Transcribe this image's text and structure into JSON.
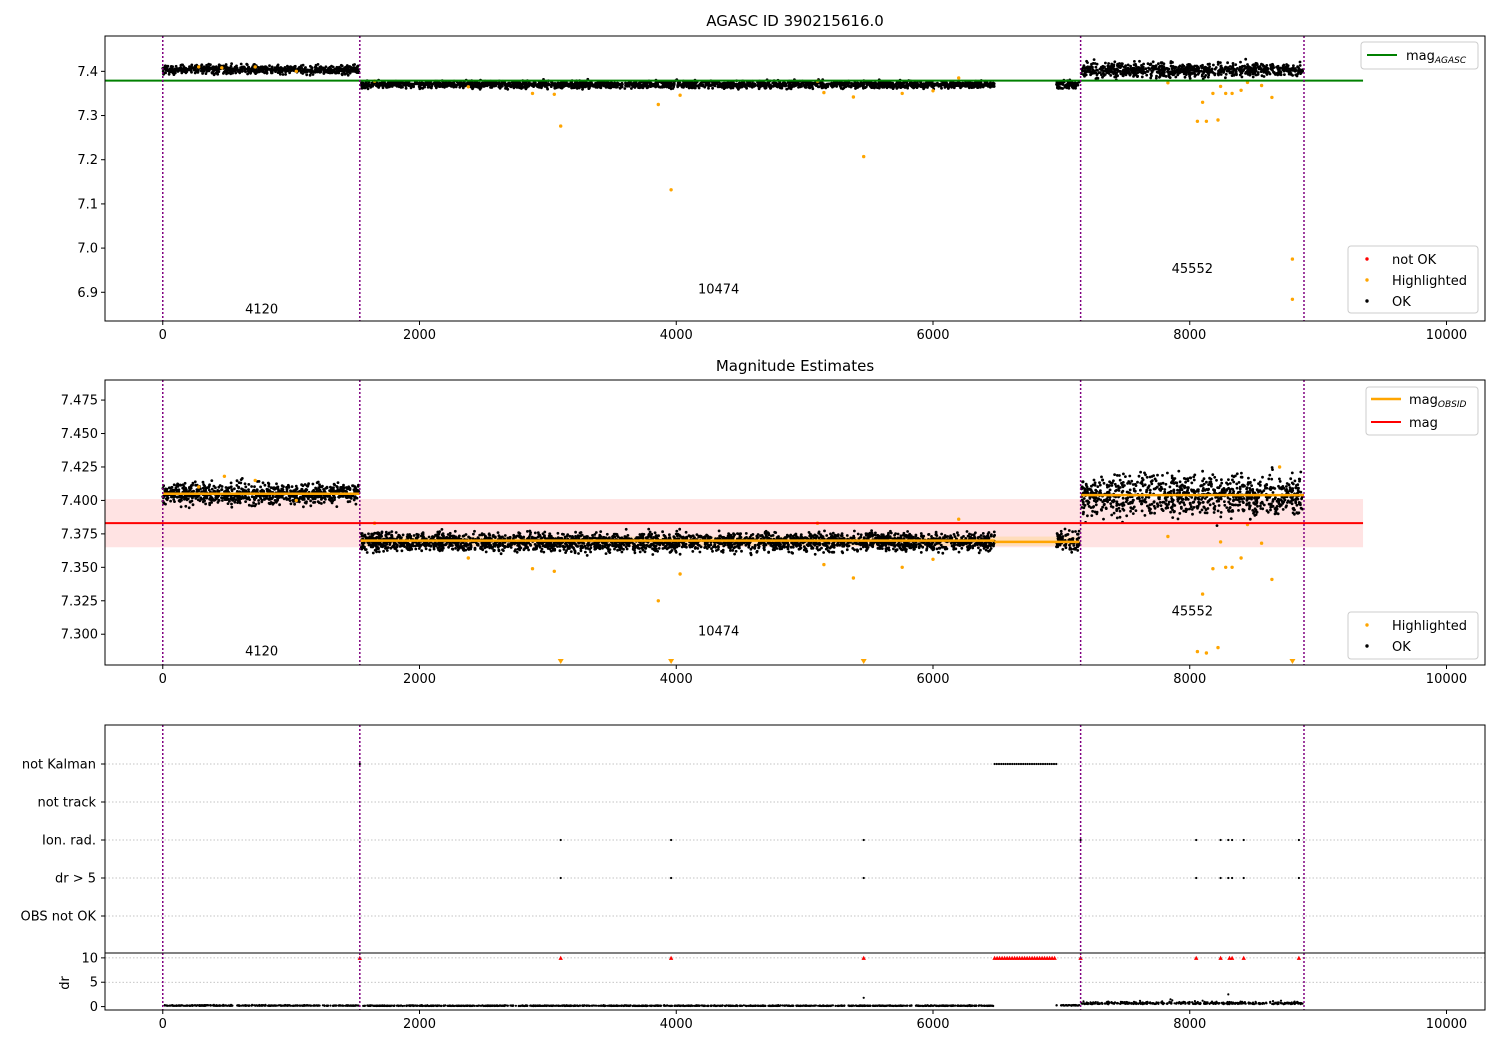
{
  "chart_data": [
    {
      "type": "scatter",
      "title": "AGASC ID 390215616.0",
      "xlim": [
        -450,
        10300
      ],
      "ylim": [
        6.835,
        7.48
      ],
      "xticks": [
        0,
        2000,
        4000,
        6000,
        8000,
        10000
      ],
      "yticks": [
        6.9,
        7.0,
        7.1,
        7.2,
        7.3,
        7.4
      ],
      "xtick_labels": [
        "0",
        "2000",
        "4000",
        "6000",
        "8000",
        "10000"
      ],
      "ytick_labels": [
        "6.9",
        "7.0",
        "7.1",
        "7.2",
        "7.3",
        "7.4"
      ],
      "obs_boundaries": [
        0,
        1535,
        7150,
        8890
      ],
      "obsid_labels": [
        {
          "text": "4120",
          "x": 770,
          "y": 6.852
        },
        {
          "text": "10474",
          "x": 4330,
          "y": 6.897
        },
        {
          "text": "45552",
          "x": 8020,
          "y": 6.944
        }
      ],
      "lines": [
        {
          "name": "mag_AGASC",
          "label_main": "mag",
          "label_sub": "AGASC",
          "color": "#008000",
          "y": 7.379,
          "x": [
            -450,
            9350
          ]
        }
      ],
      "ok_segments": [
        {
          "x": [
            0,
            1530
          ],
          "center": 7.404,
          "spread": 0.005
        },
        {
          "x": [
            1545,
            6480
          ],
          "center": 7.37,
          "spread": 0.004
        },
        {
          "x": [
            6960,
            7140
          ],
          "center": 7.37,
          "spread": 0.005
        },
        {
          "x": [
            7155,
            8880
          ],
          "center": 7.403,
          "spread": 0.008
        }
      ],
      "highlighted_points": [
        [
          280,
          7.41
        ],
        [
          460,
          7.408
        ],
        [
          720,
          7.41
        ],
        [
          1040,
          7.4
        ],
        [
          1650,
          7.378
        ],
        [
          2380,
          7.365
        ],
        [
          2880,
          7.35
        ],
        [
          3050,
          7.348
        ],
        [
          3100,
          7.276
        ],
        [
          3860,
          7.325
        ],
        [
          3960,
          7.132
        ],
        [
          4030,
          7.346
        ],
        [
          5100,
          7.378
        ],
        [
          5150,
          7.352
        ],
        [
          5380,
          7.342
        ],
        [
          5460,
          7.207
        ],
        [
          5760,
          7.35
        ],
        [
          6000,
          7.356
        ],
        [
          6200,
          7.385
        ],
        [
          7830,
          7.374
        ],
        [
          8060,
          7.287
        ],
        [
          8100,
          7.33
        ],
        [
          8130,
          7.287
        ],
        [
          8180,
          7.35
        ],
        [
          8220,
          7.29
        ],
        [
          8240,
          7.366
        ],
        [
          8280,
          7.35
        ],
        [
          8330,
          7.35
        ],
        [
          8400,
          7.357
        ],
        [
          8450,
          7.375
        ],
        [
          8560,
          7.368
        ],
        [
          8640,
          7.341
        ],
        [
          8800,
          6.975
        ],
        [
          8800,
          6.884
        ]
      ],
      "legend": {
        "position": "lower-right",
        "entries": [
          {
            "label": "not OK",
            "color": "#ff0000"
          },
          {
            "label": "Highlighted",
            "color": "#ffa500"
          },
          {
            "label": "OK",
            "color": "#000000"
          }
        ]
      }
    },
    {
      "type": "scatter",
      "title": "Magnitude Estimates",
      "xlim": [
        -450,
        10300
      ],
      "ylim": [
        7.277,
        7.49
      ],
      "xticks": [
        0,
        2000,
        4000,
        6000,
        8000,
        10000
      ],
      "yticks": [
        7.3,
        7.325,
        7.35,
        7.375,
        7.4,
        7.425,
        7.45,
        7.475
      ],
      "xtick_labels": [
        "0",
        "2000",
        "4000",
        "6000",
        "8000",
        "10000"
      ],
      "ytick_labels": [
        "7.300",
        "7.325",
        "7.350",
        "7.375",
        "7.400",
        "7.425",
        "7.450",
        "7.475"
      ],
      "obs_boundaries": [
        0,
        1535,
        7150,
        8890
      ],
      "obsid_labels": [
        {
          "text": "4120",
          "x": 770,
          "y": 7.284
        },
        {
          "text": "10474",
          "x": 4330,
          "y": 7.299
        },
        {
          "text": "45552",
          "x": 8020,
          "y": 7.314
        }
      ],
      "mag_band": {
        "x": [
          -450,
          9350
        ],
        "y": [
          7.365,
          7.401
        ],
        "color": "#ffb0b0"
      },
      "mag_obsid_band": {
        "x": [
          1545,
          7140
        ],
        "y": [
          7.366,
          7.373
        ],
        "color": "#ffd9a0"
      },
      "lines": [
        {
          "name": "mag_OBSID",
          "label_main": "mag",
          "label_sub": "OBSID",
          "color": "#ffa500",
          "segments": [
            {
              "x": [
                0,
                1535
              ],
              "y": 7.405
            },
            {
              "x": [
                1540,
                6480
              ],
              "y": 7.37
            },
            {
              "x": [
                6480,
                7140
              ],
              "y": 7.369
            },
            {
              "x": [
                7155,
                8890
              ],
              "y": 7.404
            }
          ]
        },
        {
          "name": "mag",
          "label_main": "mag",
          "label_sub": "",
          "color": "#ff0000",
          "y": 7.383,
          "x": [
            -450,
            9350
          ]
        }
      ],
      "ok_segments": [
        {
          "x": [
            0,
            1530
          ],
          "center": 7.405,
          "spread": 0.004
        },
        {
          "x": [
            1545,
            6480
          ],
          "center": 7.369,
          "spread": 0.0035
        },
        {
          "x": [
            6960,
            7140
          ],
          "center": 7.37,
          "spread": 0.004
        },
        {
          "x": [
            7155,
            8880
          ],
          "center": 7.404,
          "spread": 0.0075
        }
      ],
      "highlighted_points": [
        [
          280,
          7.41
        ],
        [
          480,
          7.418
        ],
        [
          720,
          7.415
        ],
        [
          1040,
          7.4
        ],
        [
          1650,
          7.383
        ],
        [
          2380,
          7.357
        ],
        [
          2880,
          7.349
        ],
        [
          3050,
          7.347
        ],
        [
          3860,
          7.325
        ],
        [
          4030,
          7.345
        ],
        [
          5100,
          7.383
        ],
        [
          5150,
          7.352
        ],
        [
          5380,
          7.342
        ],
        [
          5760,
          7.35
        ],
        [
          6000,
          7.356
        ],
        [
          6200,
          7.386
        ],
        [
          7830,
          7.373
        ],
        [
          8060,
          7.287
        ],
        [
          8100,
          7.33
        ],
        [
          8130,
          7.286
        ],
        [
          8180,
          7.349
        ],
        [
          8220,
          7.29
        ],
        [
          8240,
          7.369
        ],
        [
          8280,
          7.35
        ],
        [
          8330,
          7.35
        ],
        [
          8400,
          7.357
        ],
        [
          8450,
          7.382
        ],
        [
          8560,
          7.368
        ],
        [
          8640,
          7.341
        ],
        [
          8700,
          7.425
        ]
      ],
      "clipped_points": [
        [
          3100,
          7.28
        ],
        [
          3960,
          7.28
        ],
        [
          5460,
          7.28
        ],
        [
          8800,
          7.28
        ]
      ],
      "legend": {
        "position": "lower-right",
        "entries": [
          {
            "label": "Highlighted",
            "color": "#ffa500"
          },
          {
            "label": "OK",
            "color": "#000000"
          }
        ]
      }
    },
    {
      "type": "scatter",
      "title": "",
      "xlim": [
        -450,
        10300
      ],
      "categories": [
        "not Kalman",
        "not track",
        "Ion. rad.",
        "dr > 5",
        "OBS not OK"
      ],
      "obs_boundaries": [
        0,
        1535,
        7150,
        8890
      ],
      "flags": {
        "not Kalman": {
          "x": [
            1535
          ],
          "segment": [
            6480,
            6960
          ]
        },
        "not track": {
          "x": []
        },
        "Ion. rad.": {
          "x": [
            3100,
            3960,
            5460,
            7150,
            8050,
            8240,
            8300,
            8330,
            8420,
            8850
          ]
        },
        "dr > 5": {
          "x": [
            3100,
            3960,
            5460,
            7150,
            8050,
            8240,
            8300,
            8330,
            8420,
            8850
          ]
        },
        "OBS not OK": {
          "x": []
        }
      }
    },
    {
      "type": "scatter",
      "ylabel": "dr",
      "xlim": [
        -450,
        10300
      ],
      "ylim": [
        -0.7,
        11
      ],
      "yticks": [
        0,
        5,
        10
      ],
      "ytick_labels": [
        "0",
        "5",
        "10"
      ],
      "xticks": [
        0,
        2000,
        4000,
        6000,
        8000,
        10000
      ],
      "xtick_labels": [
        "0",
        "2000",
        "4000",
        "6000",
        "8000",
        "10000"
      ],
      "obs_boundaries": [
        0,
        1535,
        7150,
        8890
      ],
      "dr_segments": [
        {
          "x": [
            0,
            1530
          ],
          "center": 0.15,
          "spread": 0.1
        },
        {
          "x": [
            1545,
            6480
          ],
          "center": 0.12,
          "spread": 0.08
        },
        {
          "x": [
            6960,
            7140
          ],
          "center": 0.2,
          "spread": 0.1
        },
        {
          "x": [
            7155,
            8880
          ],
          "center": 0.5,
          "spread": 0.3
        }
      ],
      "dr_extra_points": [
        [
          5460,
          1.8
        ],
        [
          7850,
          1.5
        ],
        [
          8300,
          2.5
        ],
        [
          8100,
          1.2
        ]
      ],
      "capped_red_x": [
        1535,
        3100,
        3960,
        5460,
        7150,
        8050,
        8240,
        8310,
        8330,
        8420,
        8850
      ],
      "capped_red_segment": [
        6480,
        6960
      ],
      "capped_value": 10
    }
  ]
}
